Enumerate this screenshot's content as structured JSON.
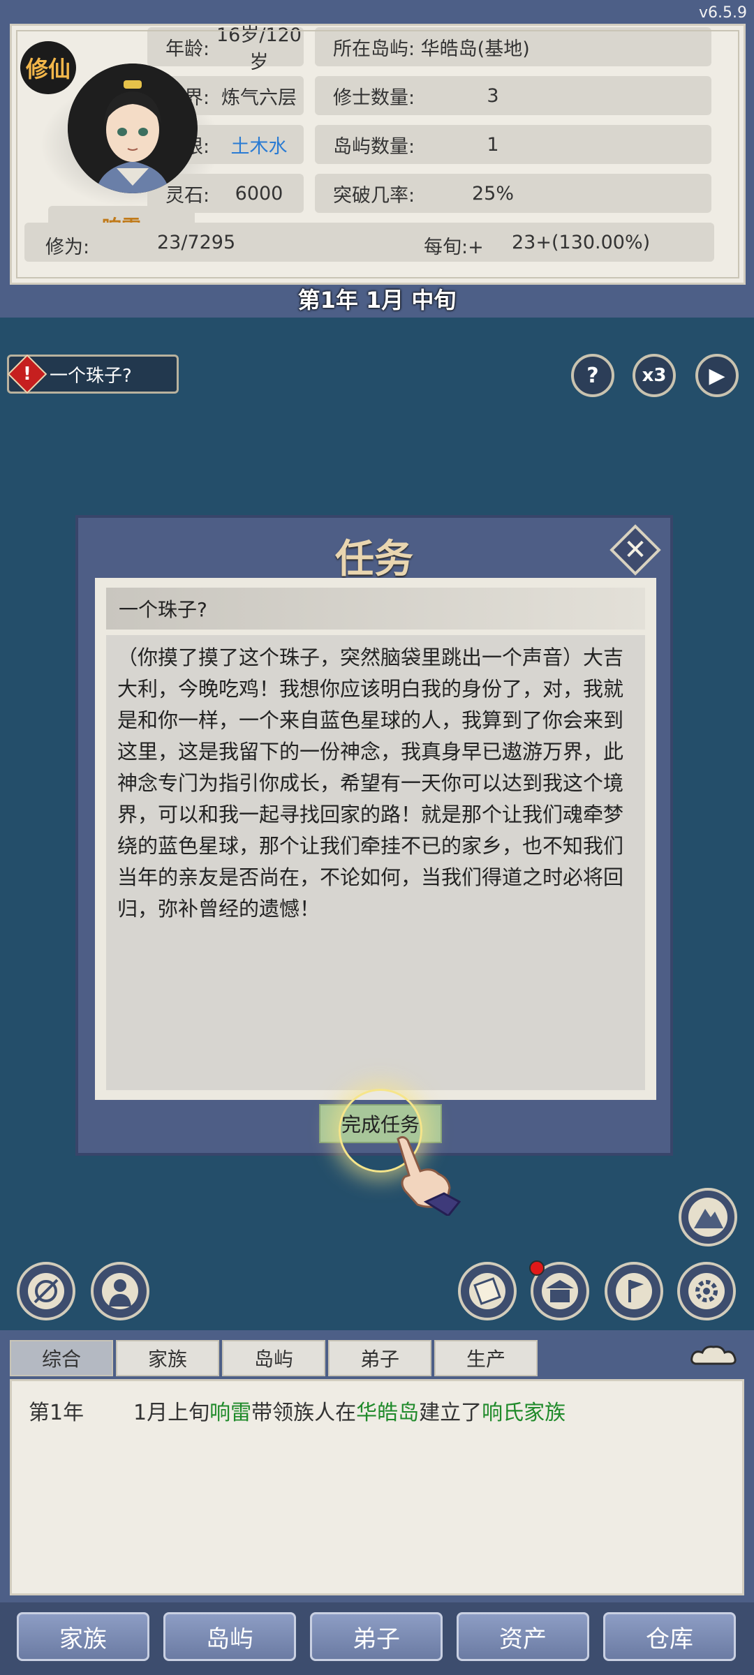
{
  "version": "v6.5.9",
  "profile": {
    "badge": "修仙",
    "name": "响雷",
    "stats_left": [
      {
        "label": "年龄:",
        "value": "16岁/120岁"
      },
      {
        "label": "境界:",
        "value": "炼气六层"
      },
      {
        "label": "灵根:",
        "value": "土木水"
      },
      {
        "label": "灵石:",
        "value": "6000"
      }
    ],
    "stats_right": [
      {
        "label": "所在岛屿: 华皓岛(基地)",
        "value": ""
      },
      {
        "label": "修士数量:",
        "value": "3"
      },
      {
        "label": "岛屿数量:",
        "value": "1"
      },
      {
        "label": "突破几率:",
        "value": "25%"
      }
    ],
    "xiuwei_label": "修为:",
    "xiuwei_value": "23/7295",
    "rate_label": "每旬:+",
    "rate_value": "23+(130.00%)",
    "accent_color": "#2a7bd3"
  },
  "date": "第1年 1月 中旬",
  "quest_tag": {
    "label": "一个珠子?",
    "icon": "warning-icon"
  },
  "controls": {
    "help": "?",
    "speed": "x3",
    "play": "▶"
  },
  "dialog": {
    "title": "任务",
    "quest_title": "一个珠子?",
    "body": "（你摸了摸了这个珠子，突然脑袋里跳出一个声音）大吉大利，今晚吃鸡！我想你应该明白我的身份了，对，我就是和你一样，一个来自蓝色星球的人，我算到了你会来到这里，这是我留下的一份神念，我真身早已遨游万界，此神念专门为指引你成长，希望有一天你可以达到我这个境界，可以和我一起寻找回家的路！就是那个让我们魂牵梦绕的蓝色星球，那个让我们牵挂不已的家乡，也不知我们当年的亲友是否尚在，不论如何，当我们得道之时必将回归，弥补曾经的遗憾！",
    "finish_label": "完成任务"
  },
  "log": {
    "tabs": [
      "综合",
      "家族",
      "岛屿",
      "弟子",
      "生产"
    ],
    "entries": [
      {
        "year": "第1年",
        "pre": "1月上旬",
        "p1": "响雷",
        "t1": "带领族人在",
        "p2": "华皓岛",
        "t2": "建立了",
        "p3": "响氏家族"
      }
    ]
  },
  "nav": [
    "家族",
    "岛屿",
    "弟子",
    "资产",
    "仓库"
  ]
}
